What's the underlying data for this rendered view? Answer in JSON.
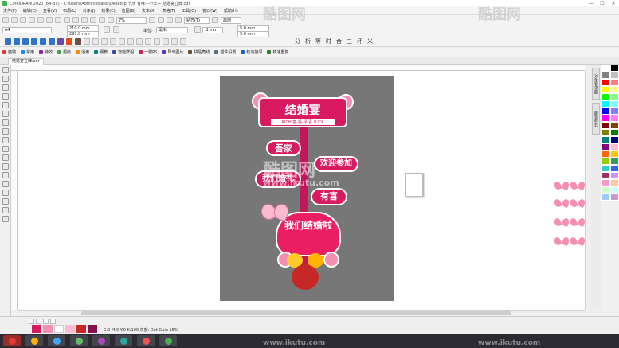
{
  "window": {
    "title": "CorelDRAW 2020 (64-Bit) - C:\\Users\\Administrator\\Desktop\\节庆 有味---小李子 结婚宴立牌.cdr",
    "controls": [
      "—",
      "☐",
      "✕"
    ]
  },
  "menu": {
    "items": [
      "文件(F)",
      "编辑(E)",
      "查看(V)",
      "布局(L)",
      "对象(J)",
      "效果(C)",
      "位图(B)",
      "文本(X)",
      "表格(T)",
      "工具(O)",
      "窗口(W)",
      "帮助(H)"
    ]
  },
  "toolbar": {
    "zoom_value": "7%",
    "snap_label": "贴齐(T)",
    "launch_label": "启动"
  },
  "properties": {
    "page_size": "A4",
    "width": "210.0 mm",
    "height": "297.0 mm",
    "units_label": "单位:",
    "units_value": "毫米",
    "nudge": ".1 mm",
    "dup_x": "5.0 mm",
    "dup_y": "5.0 mm"
  },
  "plugins": {
    "items": [
      {
        "label": "魔镜",
        "color": "#e53935"
      },
      {
        "label": "常用",
        "color": "#1e88e5"
      },
      {
        "label": "特效",
        "color": "#8e24aa"
      },
      {
        "label": "超级",
        "color": "#43a047"
      },
      {
        "label": "通用",
        "color": "#fb8c00"
      },
      {
        "label": "钢教",
        "color": "#00897b"
      },
      {
        "label": "智能群组",
        "color": "#3949ab"
      },
      {
        "label": "一键PS",
        "color": "#d81b60"
      },
      {
        "label": "导出图片",
        "color": "#5e35b1"
      },
      {
        "label": "拼贴角线",
        "color": "#6d4c41"
      },
      {
        "label": "插件设置",
        "color": "#546e7a"
      },
      {
        "label": "核速接邻",
        "color": "#1565c0"
      },
      {
        "label": "核速重复",
        "color": "#2e7d32"
      }
    ],
    "symbols": [
      "分",
      "析",
      "等",
      "时",
      "合",
      "三",
      "坏",
      "米"
    ]
  },
  "document": {
    "tab_label": "结婚宴立牌.cdr"
  },
  "artwork": {
    "title": "结婚宴",
    "subtitle": "RICH 富·福·禄·喜 LUCK",
    "sign_home": "吾家",
    "sign_welcome": "欢迎参加",
    "sign_ceremony": "我们婚礼",
    "sign_joy": "有喜",
    "heart_text": "我们结婚啦",
    "colors": {
      "magenta": "#d81b60",
      "pink_light": "#f8bbd0",
      "artboard_bg": "#777777"
    }
  },
  "dockers": {
    "tab1": "对象管理器",
    "tab2": "颜色样式"
  },
  "palette": {
    "colors": [
      "#ffffff",
      "#000000",
      "#808080",
      "#c0c0c0",
      "#ff0000",
      "#ff8080",
      "#ffff00",
      "#ffff80",
      "#00ff00",
      "#80ff80",
      "#00ffff",
      "#80ffff",
      "#0000ff",
      "#8080ff",
      "#ff00ff",
      "#ff80ff",
      "#800000",
      "#804000",
      "#808000",
      "#008000",
      "#008080",
      "#000080",
      "#800080",
      "#ffc0cb",
      "#ff6600",
      "#ffcc00",
      "#99cc00",
      "#339966",
      "#33cccc",
      "#3366ff",
      "#993366",
      "#cc99ff",
      "#ff99cc",
      "#ffcc99",
      "#ccffcc",
      "#ccffff",
      "#99ccff",
      "#cc99cc"
    ]
  },
  "status": {
    "text": "C:0 M:0 Y:0 K:100  灰度: Dot Gain 15%"
  },
  "watermark": {
    "text": "酷图网",
    "url": "www.ikutu.com"
  }
}
